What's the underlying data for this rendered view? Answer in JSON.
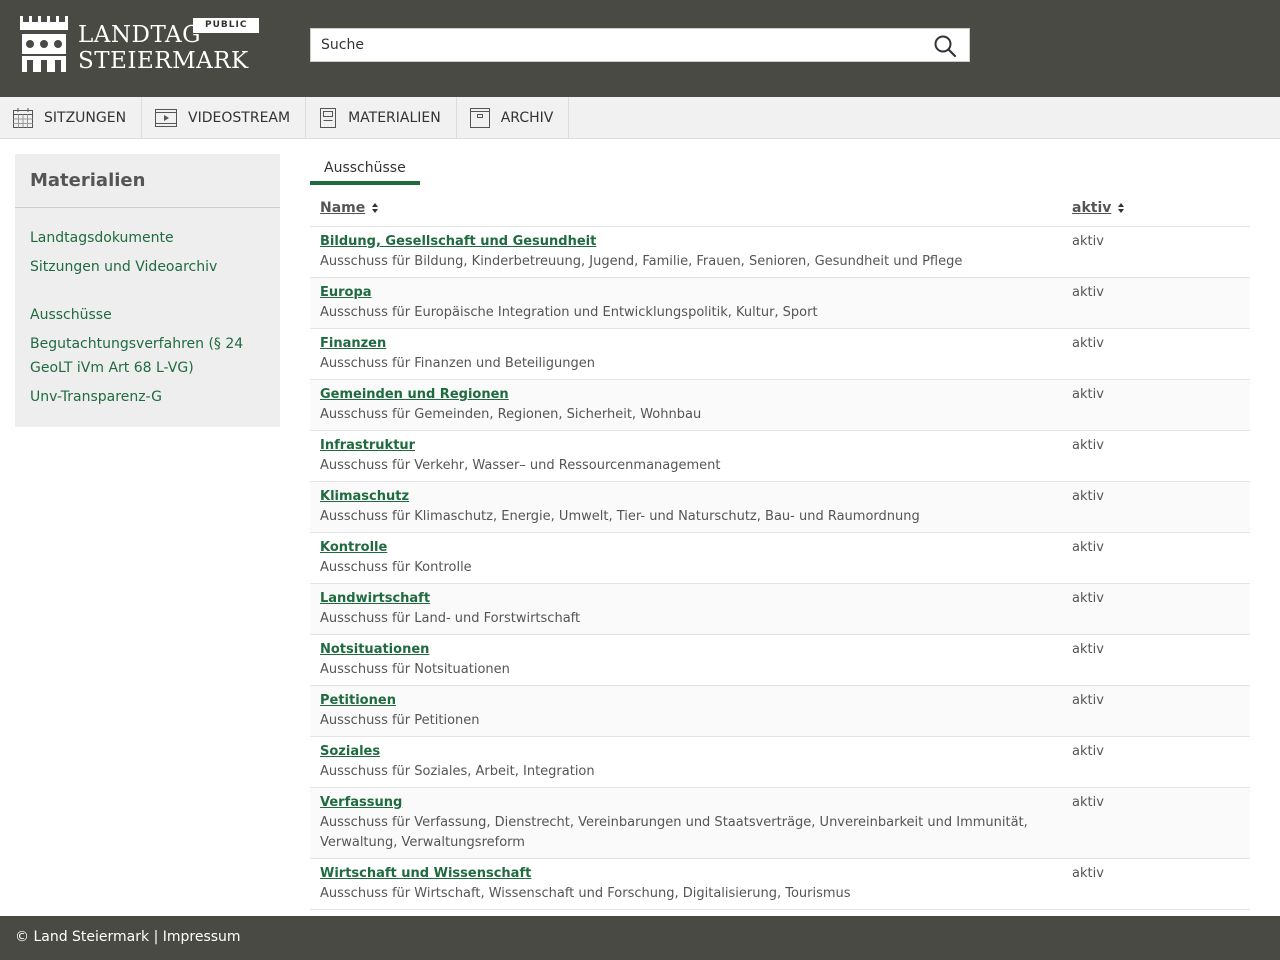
{
  "header": {
    "logo_line1": "LANDTAG",
    "logo_line2": "STEIERMARK",
    "badge": "PUBLIC",
    "search_placeholder": "Suche"
  },
  "nav": [
    {
      "label": "Sitzungen",
      "icon": "calendar-icon"
    },
    {
      "label": "Videostream",
      "icon": "video-icon"
    },
    {
      "label": "Materialien",
      "icon": "document-icon"
    },
    {
      "label": "Archiv",
      "icon": "archive-icon"
    }
  ],
  "sidebar": {
    "title": "Materialien",
    "links_top": [
      "Landtagsdokumente",
      "Sitzungen und Videoarchiv"
    ],
    "links_bottom": [
      "Ausschüsse",
      "Begutachtungsverfahren (§ 24 GeoLT iVm Art 68 L-VG)",
      "Unv-Transparenz-G"
    ]
  },
  "main": {
    "tab": "Ausschüsse",
    "col_name": "Name",
    "col_aktiv": "aktiv",
    "rows": [
      {
        "title": "Bildung, Gesellschaft und Gesundheit",
        "desc": "Ausschuss für Bildung, Kinderbetreuung, Jugend, Familie, Frauen, Senioren, Gesundheit und Pflege",
        "status": "aktiv"
      },
      {
        "title": "Europa",
        "desc": "Ausschuss für Europäische Integration und Entwicklungspolitik, Kultur, Sport",
        "status": "aktiv"
      },
      {
        "title": "Finanzen",
        "desc": "Ausschuss für Finanzen und Beteiligungen",
        "status": "aktiv"
      },
      {
        "title": "Gemeinden und Regionen",
        "desc": "Ausschuss für Gemeinden, Regionen, Sicherheit, Wohnbau",
        "status": "aktiv"
      },
      {
        "title": "Infrastruktur",
        "desc": "Ausschuss für Verkehr, Wasser– und Ressourcenmanagement",
        "status": "aktiv"
      },
      {
        "title": "Klimaschutz",
        "desc": "Ausschuss für Klimaschutz, Energie, Umwelt, Tier- und Naturschutz, Bau- und Raumordnung",
        "status": "aktiv"
      },
      {
        "title": "Kontrolle",
        "desc": "Ausschuss für Kontrolle",
        "status": "aktiv"
      },
      {
        "title": "Landwirtschaft",
        "desc": "Ausschuss für Land- und Forstwirtschaft",
        "status": "aktiv"
      },
      {
        "title": "Notsituationen",
        "desc": "Ausschuss für Notsituationen",
        "status": "aktiv"
      },
      {
        "title": "Petitionen",
        "desc": "Ausschuss für Petitionen",
        "status": "aktiv"
      },
      {
        "title": "Soziales",
        "desc": "Ausschuss für Soziales, Arbeit, Integration",
        "status": "aktiv"
      },
      {
        "title": "Verfassung",
        "desc": "Ausschuss für Verfassung, Dienstrecht, Vereinbarungen und Staatsverträge, Unvereinbarkeit und Immunität, Verwaltung, Verwaltungsreform",
        "status": "aktiv"
      },
      {
        "title": "Wirtschaft und Wissenschaft",
        "desc": "Ausschuss für Wirtschaft, Wissenschaft und Forschung, Digitalisierung, Tourismus",
        "status": "aktiv"
      }
    ]
  },
  "footer": {
    "copyright": "© Land Steiermark",
    "separator": "|",
    "impressum": "Impressum"
  },
  "colors": {
    "header_bg": "#4a4a44",
    "accent_green": "#1f6b3f",
    "nav_bg": "#f1f1f1",
    "sidebar_bg": "#eeeeee"
  }
}
